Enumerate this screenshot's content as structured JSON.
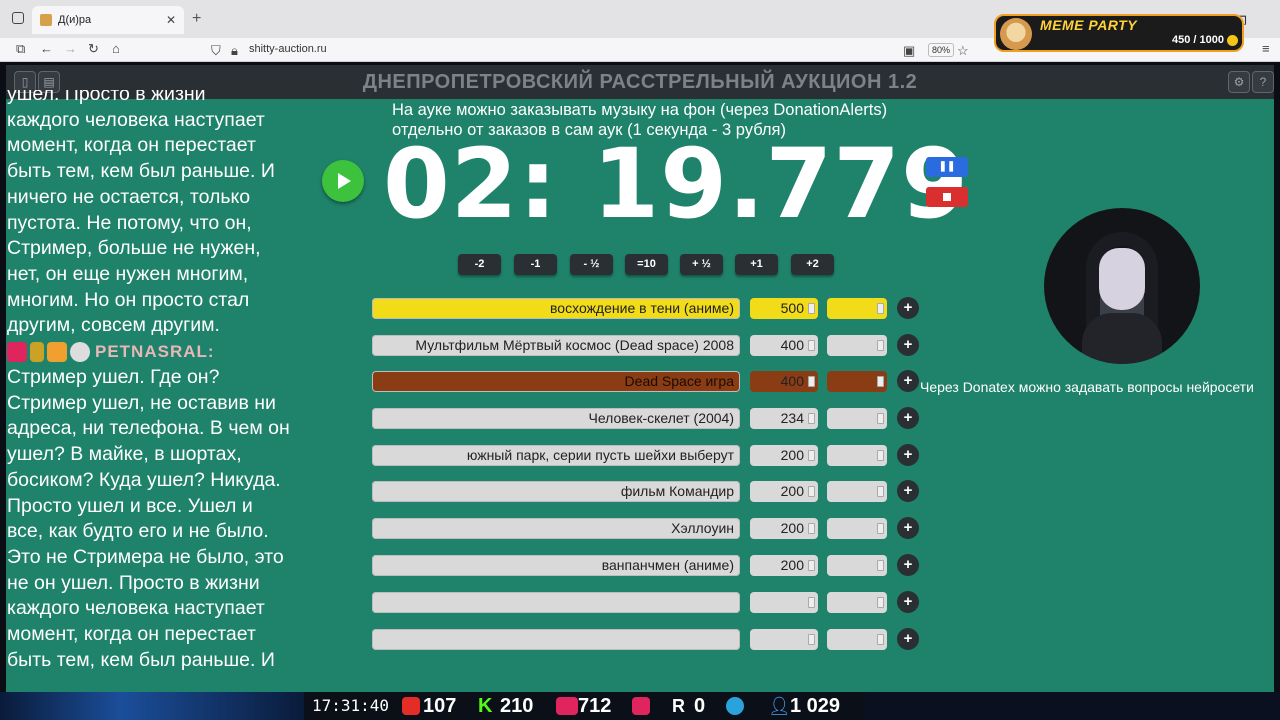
{
  "browser": {
    "tab_title": "Д(и)ра",
    "url": "shitty-auction.ru",
    "zoom": "80%"
  },
  "overlay": {
    "meme_title": "MEME PARTY",
    "meme_count": "450 / 1000"
  },
  "app": {
    "title": "ДНЕПРОПЕТРОВСКИЙ РАССТРЕЛЬНЫЙ АУКЦИОН 1.2",
    "info_text": "На ауке можно заказывать музыку на фон (через DonationAlerts)\nотдельно от заказов в сам аук (1 секунда - 3 рубля)",
    "timer": "02: 19.779",
    "donatex_text": "Через Donatex можно задавать вопросы нейросети"
  },
  "chat": {
    "text1": "ушел. Просто в жизни\nкаждого человека наступает\nмомент, когда он перестает\nбыть тем, кем был раньше. И\nничего не остается, только\nпустота. Не потому, что он,\nСтример, больше не нужен,\nнет, он еще нужен многим,\nмногим. Но он просто стал\nдругим, совсем другим.",
    "nick": "PETNASRAL:",
    "text2": "Стример ушел. Где он?\nСтример ушел, не оставив ни\nадреса, ни телефона. В чем он\nушел? В майке, в шортах,\nбосиком? Куда ушел? Никуда.\nПросто ушел и все. Ушел и\nвсе, как будто его и не было.\nЭто не Стримера не было, это\nне он ушел. Просто в жизни\nкаждого человека наступает\nмомент, когда он перестает\nбыть тем, кем был раньше. И"
  },
  "adjust_buttons": [
    "-2",
    "-1",
    "- ½",
    "=10",
    "+ ½",
    "+1",
    "+2"
  ],
  "lots": [
    {
      "name": "восхождение в тени (аниме)",
      "value": "500",
      "color": "#f2dc1a"
    },
    {
      "name": "Мультфильм Мёртвый космос (Dead space) 2008",
      "value": "400",
      "color": "#d9d9d9"
    },
    {
      "name": "Dead Space игра",
      "value": "400",
      "color": "#8a3d14"
    },
    {
      "name": "Человек-скелет (2004)",
      "value": "234",
      "color": "#d9d9d9"
    },
    {
      "name": "южный парк, серии пусть шейхи выберут",
      "value": "200",
      "color": "#d9d9d9"
    },
    {
      "name": "фильм Командир",
      "value": "200",
      "color": "#d9d9d9"
    },
    {
      "name": "Хэллоуин",
      "value": "200",
      "color": "#d9d9d9"
    },
    {
      "name": "ванпанчмен (аниме)",
      "value": "200",
      "color": "#d9d9d9"
    },
    {
      "name": "",
      "value": "",
      "color": "#d9d9d9"
    },
    {
      "name": "",
      "value": "",
      "color": "#d9d9d9"
    }
  ],
  "stats": {
    "clock": "17:31:40",
    "youtube": "107",
    "kick": "210",
    "live": "712",
    "play": "",
    "rumble": "0",
    "viewers": "1 029"
  },
  "icons": {
    "youtube_color": "#e52d27",
    "kick_color": "#53fc18",
    "live_color": "#e0245e",
    "telegram_color": "#2aa3dd",
    "viewers_color": "#4aa3ff"
  }
}
